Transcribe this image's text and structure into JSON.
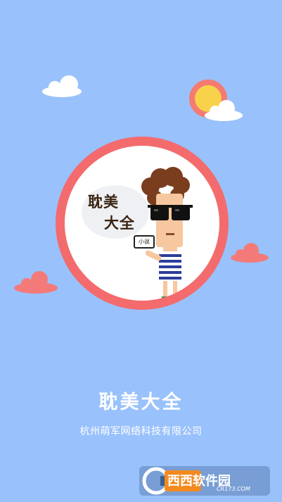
{
  "splash": {
    "app_title": "耽美大全",
    "company": "杭州萌军网络科技有限公司",
    "logo": {
      "text_line1": "耽美",
      "text_line2": "大全",
      "phone_label": "小说"
    }
  },
  "watermark": {
    "brand": "西西软件园",
    "url": "CR173.COM"
  },
  "colors": {
    "background": "#99c1fb",
    "accent_red": "#f36b6d",
    "sun": "#f7d24a"
  },
  "icons": [
    "cloud-icon",
    "sun-icon",
    "character-illustration",
    "sunglasses-icon",
    "phone-icon",
    "watermark-logo"
  ]
}
